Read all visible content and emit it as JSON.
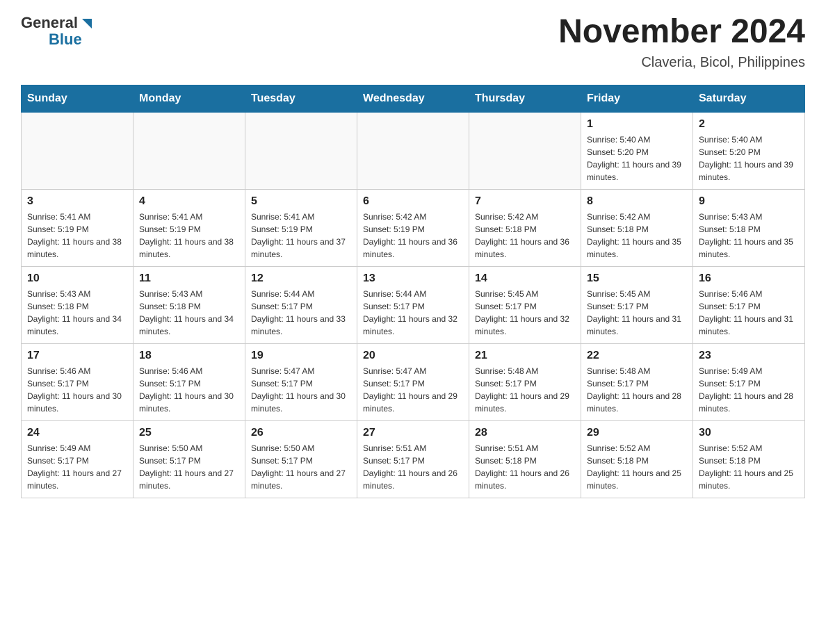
{
  "header": {
    "logo": {
      "general": "General",
      "blue": "Blue",
      "triangle_color": "#1a6fa0"
    },
    "title": "November 2024",
    "subtitle": "Claveria, Bicol, Philippines"
  },
  "days_of_week": [
    "Sunday",
    "Monday",
    "Tuesday",
    "Wednesday",
    "Thursday",
    "Friday",
    "Saturday"
  ],
  "weeks": [
    [
      {
        "day": "",
        "sunrise": "",
        "sunset": "",
        "daylight": ""
      },
      {
        "day": "",
        "sunrise": "",
        "sunset": "",
        "daylight": ""
      },
      {
        "day": "",
        "sunrise": "",
        "sunset": "",
        "daylight": ""
      },
      {
        "day": "",
        "sunrise": "",
        "sunset": "",
        "daylight": ""
      },
      {
        "day": "",
        "sunrise": "",
        "sunset": "",
        "daylight": ""
      },
      {
        "day": "1",
        "sunrise": "Sunrise: 5:40 AM",
        "sunset": "Sunset: 5:20 PM",
        "daylight": "Daylight: 11 hours and 39 minutes."
      },
      {
        "day": "2",
        "sunrise": "Sunrise: 5:40 AM",
        "sunset": "Sunset: 5:20 PM",
        "daylight": "Daylight: 11 hours and 39 minutes."
      }
    ],
    [
      {
        "day": "3",
        "sunrise": "Sunrise: 5:41 AM",
        "sunset": "Sunset: 5:19 PM",
        "daylight": "Daylight: 11 hours and 38 minutes."
      },
      {
        "day": "4",
        "sunrise": "Sunrise: 5:41 AM",
        "sunset": "Sunset: 5:19 PM",
        "daylight": "Daylight: 11 hours and 38 minutes."
      },
      {
        "day": "5",
        "sunrise": "Sunrise: 5:41 AM",
        "sunset": "Sunset: 5:19 PM",
        "daylight": "Daylight: 11 hours and 37 minutes."
      },
      {
        "day": "6",
        "sunrise": "Sunrise: 5:42 AM",
        "sunset": "Sunset: 5:19 PM",
        "daylight": "Daylight: 11 hours and 36 minutes."
      },
      {
        "day": "7",
        "sunrise": "Sunrise: 5:42 AM",
        "sunset": "Sunset: 5:18 PM",
        "daylight": "Daylight: 11 hours and 36 minutes."
      },
      {
        "day": "8",
        "sunrise": "Sunrise: 5:42 AM",
        "sunset": "Sunset: 5:18 PM",
        "daylight": "Daylight: 11 hours and 35 minutes."
      },
      {
        "day": "9",
        "sunrise": "Sunrise: 5:43 AM",
        "sunset": "Sunset: 5:18 PM",
        "daylight": "Daylight: 11 hours and 35 minutes."
      }
    ],
    [
      {
        "day": "10",
        "sunrise": "Sunrise: 5:43 AM",
        "sunset": "Sunset: 5:18 PM",
        "daylight": "Daylight: 11 hours and 34 minutes."
      },
      {
        "day": "11",
        "sunrise": "Sunrise: 5:43 AM",
        "sunset": "Sunset: 5:18 PM",
        "daylight": "Daylight: 11 hours and 34 minutes."
      },
      {
        "day": "12",
        "sunrise": "Sunrise: 5:44 AM",
        "sunset": "Sunset: 5:17 PM",
        "daylight": "Daylight: 11 hours and 33 minutes."
      },
      {
        "day": "13",
        "sunrise": "Sunrise: 5:44 AM",
        "sunset": "Sunset: 5:17 PM",
        "daylight": "Daylight: 11 hours and 32 minutes."
      },
      {
        "day": "14",
        "sunrise": "Sunrise: 5:45 AM",
        "sunset": "Sunset: 5:17 PM",
        "daylight": "Daylight: 11 hours and 32 minutes."
      },
      {
        "day": "15",
        "sunrise": "Sunrise: 5:45 AM",
        "sunset": "Sunset: 5:17 PM",
        "daylight": "Daylight: 11 hours and 31 minutes."
      },
      {
        "day": "16",
        "sunrise": "Sunrise: 5:46 AM",
        "sunset": "Sunset: 5:17 PM",
        "daylight": "Daylight: 11 hours and 31 minutes."
      }
    ],
    [
      {
        "day": "17",
        "sunrise": "Sunrise: 5:46 AM",
        "sunset": "Sunset: 5:17 PM",
        "daylight": "Daylight: 11 hours and 30 minutes."
      },
      {
        "day": "18",
        "sunrise": "Sunrise: 5:46 AM",
        "sunset": "Sunset: 5:17 PM",
        "daylight": "Daylight: 11 hours and 30 minutes."
      },
      {
        "day": "19",
        "sunrise": "Sunrise: 5:47 AM",
        "sunset": "Sunset: 5:17 PM",
        "daylight": "Daylight: 11 hours and 30 minutes."
      },
      {
        "day": "20",
        "sunrise": "Sunrise: 5:47 AM",
        "sunset": "Sunset: 5:17 PM",
        "daylight": "Daylight: 11 hours and 29 minutes."
      },
      {
        "day": "21",
        "sunrise": "Sunrise: 5:48 AM",
        "sunset": "Sunset: 5:17 PM",
        "daylight": "Daylight: 11 hours and 29 minutes."
      },
      {
        "day": "22",
        "sunrise": "Sunrise: 5:48 AM",
        "sunset": "Sunset: 5:17 PM",
        "daylight": "Daylight: 11 hours and 28 minutes."
      },
      {
        "day": "23",
        "sunrise": "Sunrise: 5:49 AM",
        "sunset": "Sunset: 5:17 PM",
        "daylight": "Daylight: 11 hours and 28 minutes."
      }
    ],
    [
      {
        "day": "24",
        "sunrise": "Sunrise: 5:49 AM",
        "sunset": "Sunset: 5:17 PM",
        "daylight": "Daylight: 11 hours and 27 minutes."
      },
      {
        "day": "25",
        "sunrise": "Sunrise: 5:50 AM",
        "sunset": "Sunset: 5:17 PM",
        "daylight": "Daylight: 11 hours and 27 minutes."
      },
      {
        "day": "26",
        "sunrise": "Sunrise: 5:50 AM",
        "sunset": "Sunset: 5:17 PM",
        "daylight": "Daylight: 11 hours and 27 minutes."
      },
      {
        "day": "27",
        "sunrise": "Sunrise: 5:51 AM",
        "sunset": "Sunset: 5:17 PM",
        "daylight": "Daylight: 11 hours and 26 minutes."
      },
      {
        "day": "28",
        "sunrise": "Sunrise: 5:51 AM",
        "sunset": "Sunset: 5:18 PM",
        "daylight": "Daylight: 11 hours and 26 minutes."
      },
      {
        "day": "29",
        "sunrise": "Sunrise: 5:52 AM",
        "sunset": "Sunset: 5:18 PM",
        "daylight": "Daylight: 11 hours and 25 minutes."
      },
      {
        "day": "30",
        "sunrise": "Sunrise: 5:52 AM",
        "sunset": "Sunset: 5:18 PM",
        "daylight": "Daylight: 11 hours and 25 minutes."
      }
    ]
  ]
}
